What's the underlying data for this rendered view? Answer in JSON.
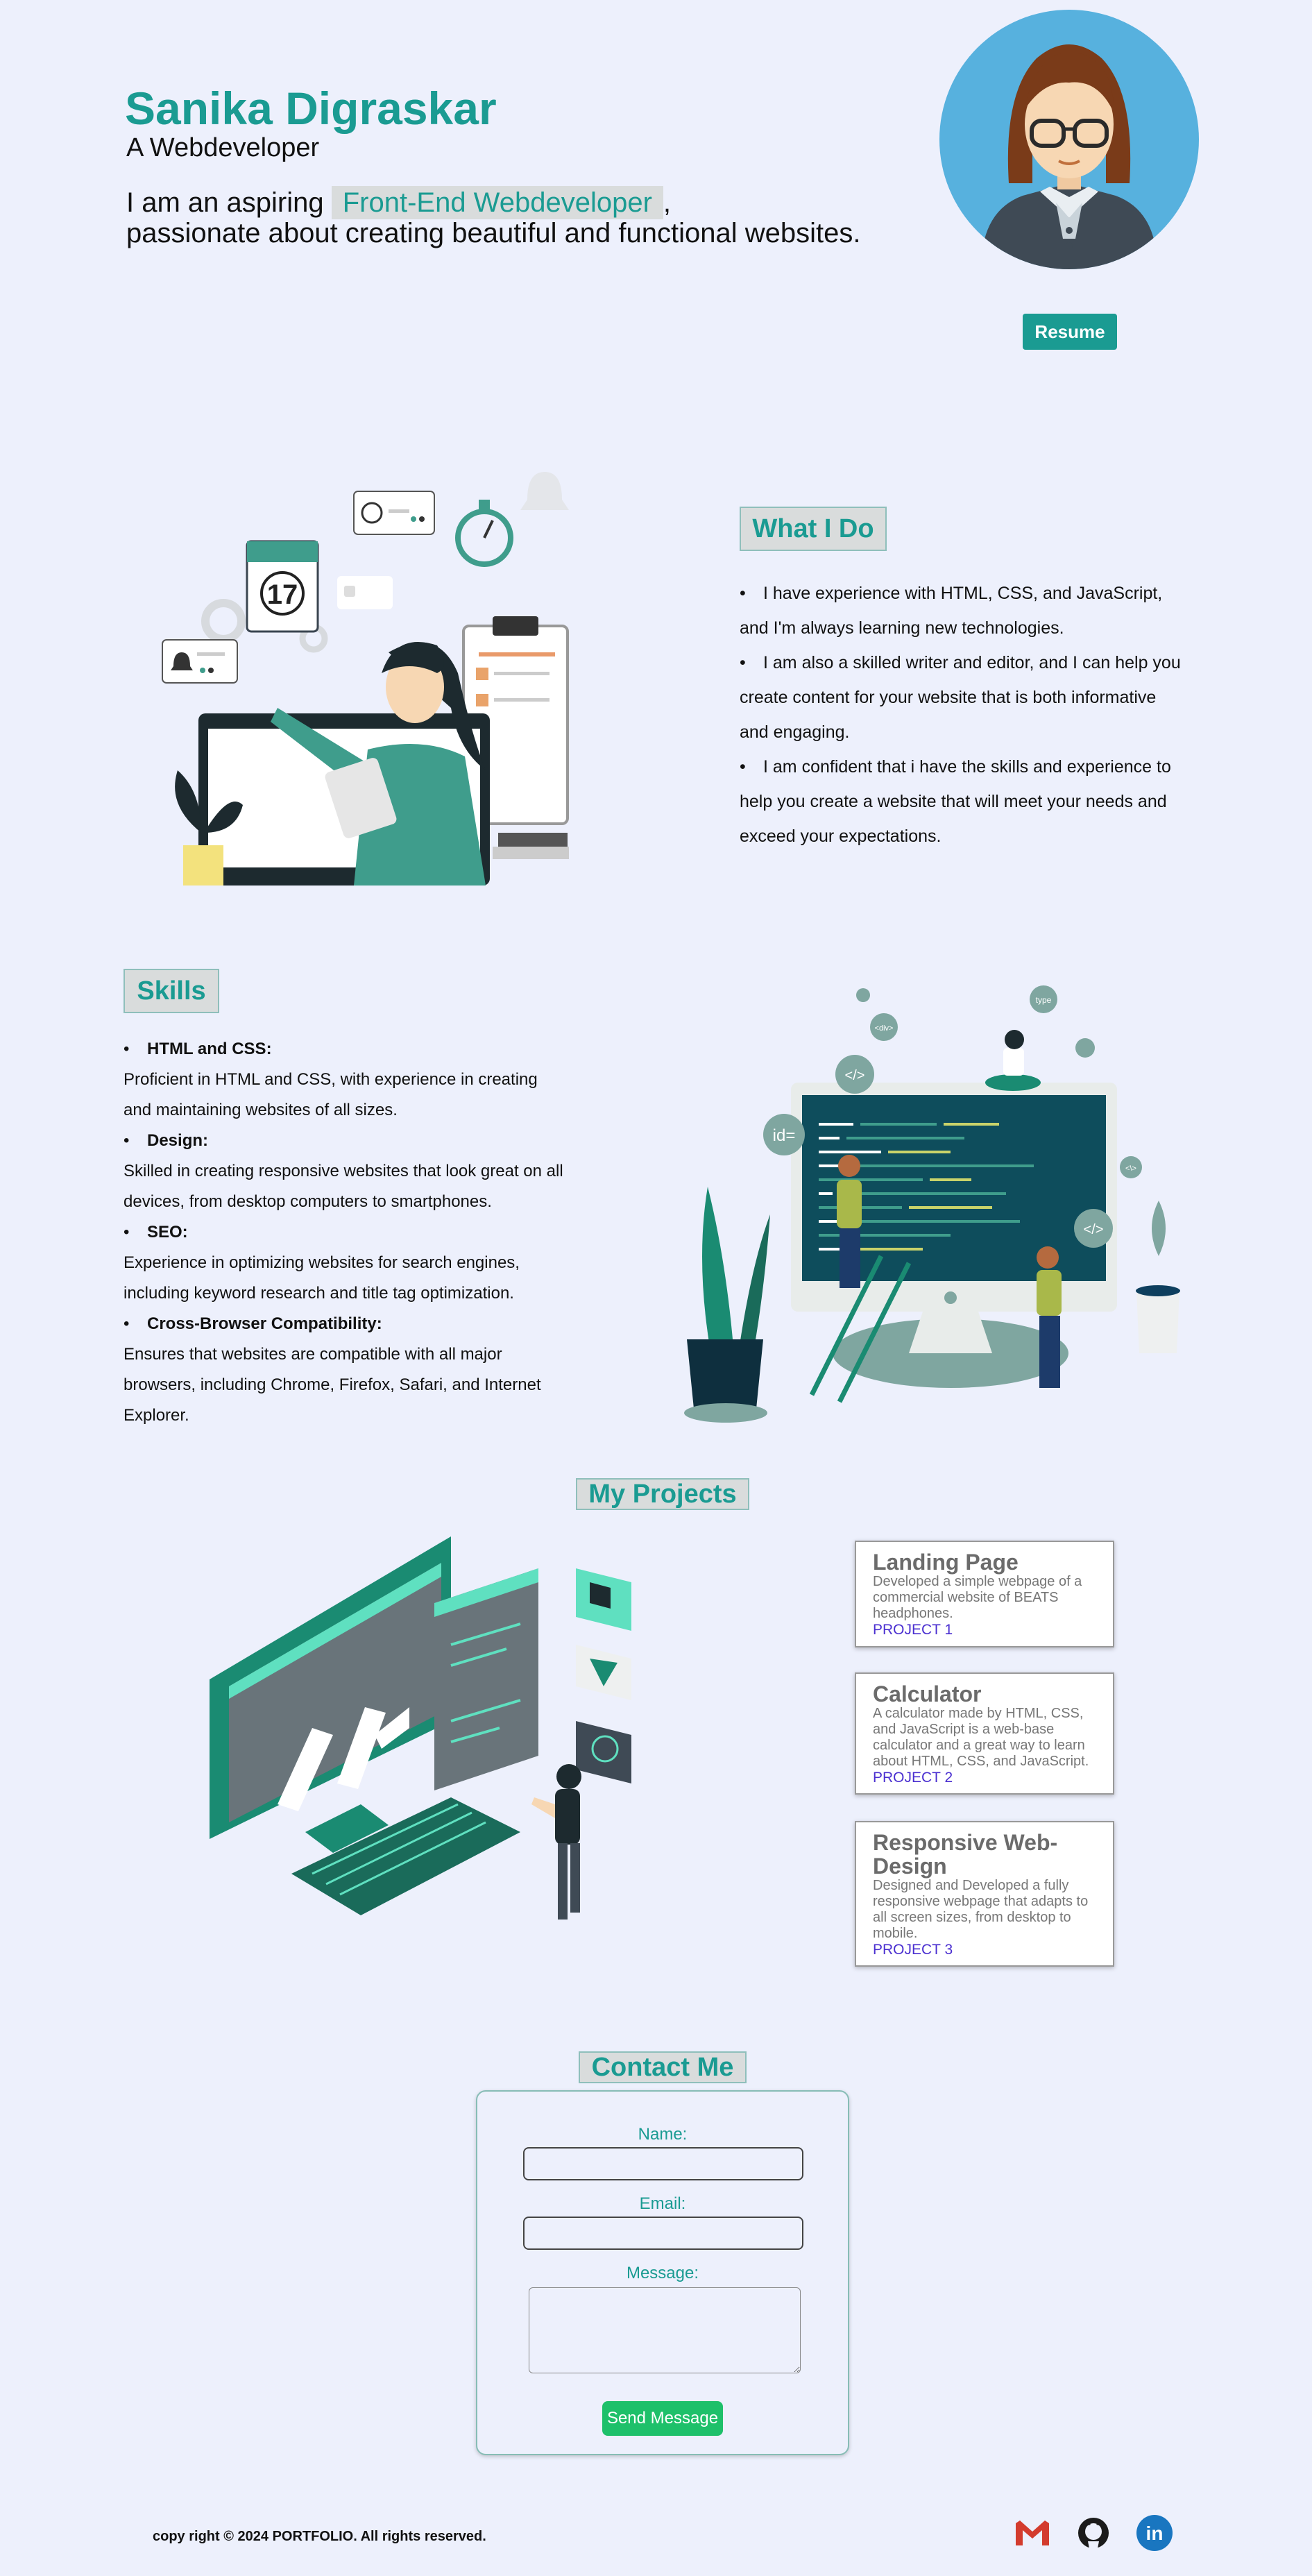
{
  "header": {
    "name": "Sanika Digraskar",
    "role": "A Webdeveloper",
    "intro_prefix": "I am an aspiring",
    "intro_highlight": "Front-End Webdeveloper",
    "intro_suffix": ",",
    "intro_line2": "passionate about creating beautiful and functional websites.",
    "resume_label": "Resume"
  },
  "what_i_do": {
    "heading": "What I Do",
    "items": [
      "I have experience with HTML, CSS, and JavaScript, and I'm always learning new technologies.",
      "I am also a skilled writer and editor, and I can help you create content for your website that is both informative and engaging.",
      "I am confident that i have the skills and experience to help you create a website that will meet your needs and exceed your expectations."
    ]
  },
  "skills": {
    "heading": "Skills",
    "items": [
      {
        "title": "HTML and CSS:",
        "desc": "Proficient in HTML and CSS, with experience in creating and maintaining websites of all sizes."
      },
      {
        "title": "Design:",
        "desc": "Skilled in creating responsive websites that look great on all devices, from desktop computers to smartphones."
      },
      {
        "title": "SEO:",
        "desc": "Experience in optimizing websites for search engines, including keyword research and title tag optimization."
      },
      {
        "title": "Cross-Browser Compatibility:",
        "desc": "Ensures that websites are compatible with all major browsers, including Chrome, Firefox, Safari, and Internet Explorer."
      }
    ]
  },
  "projects": {
    "heading": "My Projects",
    "cards": [
      {
        "title": "Landing Page",
        "desc": "Developed a simple webpage of a commercial website of BEATS headphones.",
        "link": "PROJECT 1"
      },
      {
        "title": "Calculator",
        "desc": "A calculator made by HTML, CSS, and JavaScript is a web-base calculator and a great way to learn about HTML, CSS, and JavaScript.",
        "link": "PROJECT 2"
      },
      {
        "title": "Responsive Web-Design",
        "desc": "Designed and Developed a fully responsive webpage that adapts to all screen sizes, from desktop to mobile.",
        "link": "PROJECT 3"
      }
    ]
  },
  "contact": {
    "heading": "Contact Me",
    "name_label": "Name:",
    "email_label": "Email:",
    "message_label": "Message:",
    "name_value": "",
    "email_value": "",
    "message_value": "",
    "send_label": "Send Message"
  },
  "footer": {
    "copyright": "copy right © 2024 PORTFOLIO. All rights reserved.",
    "icons": [
      "gmail-icon",
      "github-icon",
      "linkedin-icon"
    ],
    "linkedin_text": "in"
  },
  "colors": {
    "accent": "#1a9b92",
    "background": "#edf0fc",
    "send_button": "#1ec06a",
    "link": "#4a2fd0"
  },
  "illus": {
    "calendar_day": "17",
    "tag_id": "id=",
    "tag_code": "</>",
    "tag_type": "type",
    "tag_div": "<div>",
    "tag_close": "<\\>",
    "big_code": "</>"
  }
}
